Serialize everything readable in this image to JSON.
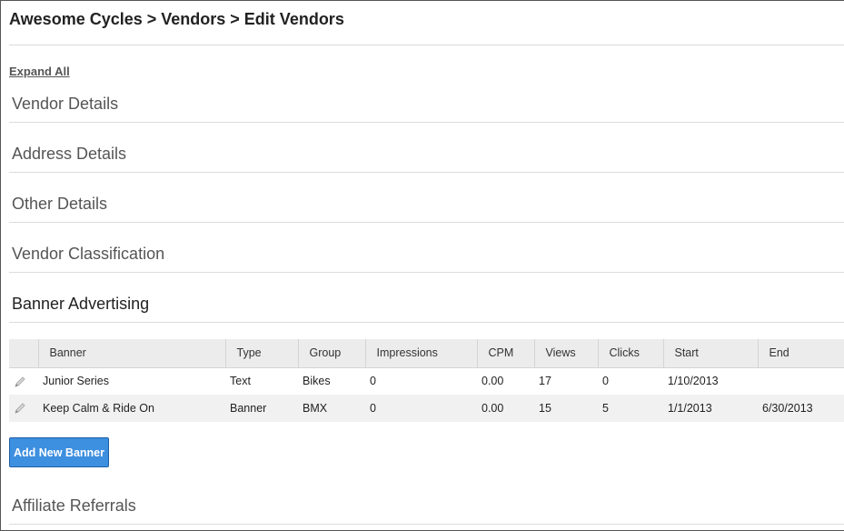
{
  "breadcrumb": "Awesome Cycles > Vendors > Edit Vendors",
  "expand_all": "Expand All",
  "sections": [
    {
      "label": "Vendor Details"
    },
    {
      "label": "Address Details"
    },
    {
      "label": "Other Details"
    },
    {
      "label": "Vendor Classification"
    },
    {
      "label": "Banner Advertising"
    }
  ],
  "banner_table": {
    "columns": [
      "Banner",
      "Type",
      "Group",
      "Impressions",
      "CPM",
      "Views",
      "Clicks",
      "Start",
      "End"
    ],
    "rows": [
      [
        "Junior Series",
        "Text",
        "Bikes",
        "0",
        "0.00",
        "17",
        "0",
        "1/10/2013",
        ""
      ],
      [
        "Keep Calm & Ride On",
        "Banner",
        "BMX",
        "0",
        "0.00",
        "15",
        "5",
        "1/1/2013",
        "6/30/2013"
      ]
    ]
  },
  "add_button": "Add New Banner",
  "last_section": {
    "label": "Affiliate Referrals"
  },
  "colors": {
    "accent": "#3d8fe0"
  }
}
